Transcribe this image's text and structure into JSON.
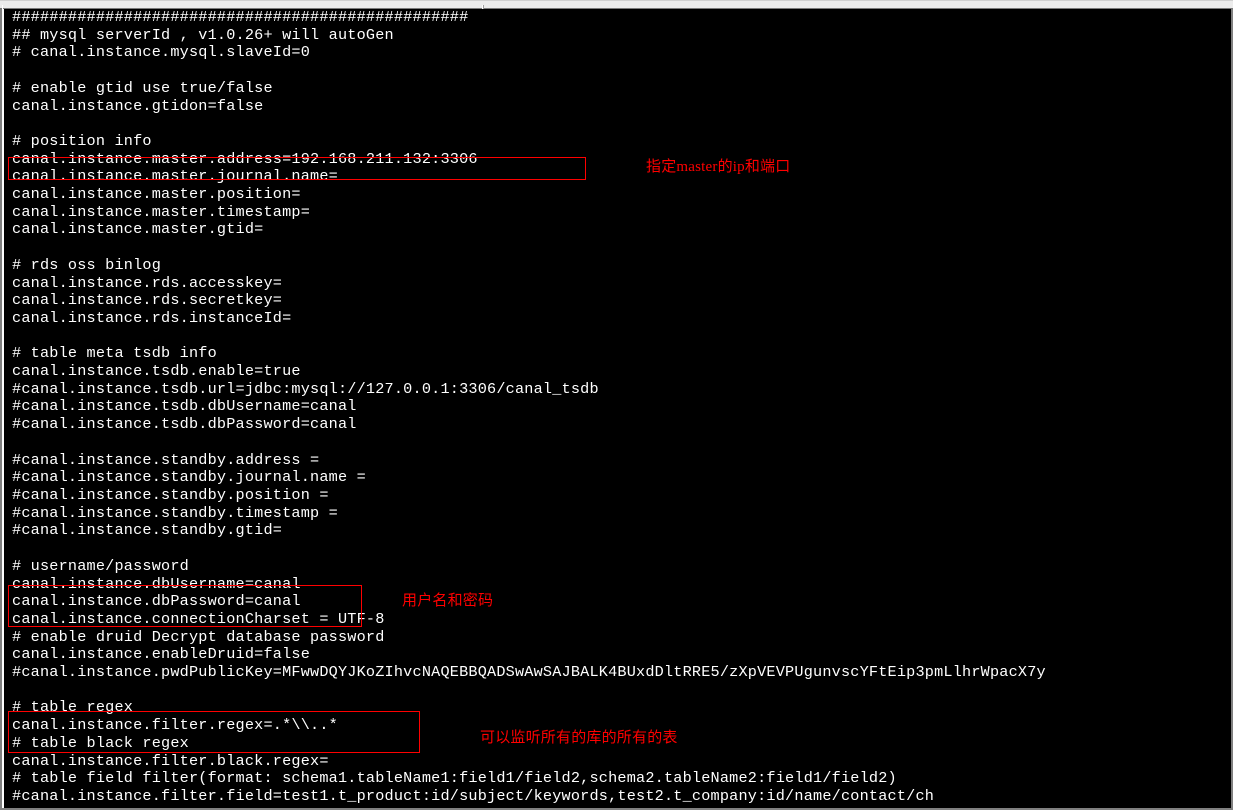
{
  "config_lines": [
    "#################################################",
    "## mysql serverId , v1.0.26+ will autoGen",
    "# canal.instance.mysql.slaveId=0",
    "",
    "# enable gtid use true/false",
    "canal.instance.gtidon=false",
    "",
    "# position info",
    "canal.instance.master.address=192.168.211.132:3306",
    "canal.instance.master.journal.name=",
    "canal.instance.master.position=",
    "canal.instance.master.timestamp=",
    "canal.instance.master.gtid=",
    "",
    "# rds oss binlog",
    "canal.instance.rds.accesskey=",
    "canal.instance.rds.secretkey=",
    "canal.instance.rds.instanceId=",
    "",
    "# table meta tsdb info",
    "canal.instance.tsdb.enable=true",
    "#canal.instance.tsdb.url=jdbc:mysql://127.0.0.1:3306/canal_tsdb",
    "#canal.instance.tsdb.dbUsername=canal",
    "#canal.instance.tsdb.dbPassword=canal",
    "",
    "#canal.instance.standby.address =",
    "#canal.instance.standby.journal.name =",
    "#canal.instance.standby.position =",
    "#canal.instance.standby.timestamp =",
    "#canal.instance.standby.gtid=",
    "",
    "# username/password",
    "canal.instance.dbUsername=canal",
    "canal.instance.dbPassword=canal",
    "canal.instance.connectionCharset = UTF-8",
    "# enable druid Decrypt database password",
    "canal.instance.enableDruid=false",
    "#canal.instance.pwdPublicKey=MFwwDQYJKoZIhvcNAQEBBQADSwAwSAJBALK4BUxdDltRRE5/zXpVEVPUgunvscYFtEip3pmLlhrWpacX7y",
    "",
    "# table regex",
    "canal.instance.filter.regex=.*\\\\..*",
    "# table black regex",
    "canal.instance.filter.black.regex=",
    "# table field filter(format: schema1.tableName1:field1/field2,schema2.tableName2:field1/field2)",
    "#canal.instance.filter.field=test1.t_product:id/subject/keywords,test2.t_company:id/name/contact/ch"
  ],
  "annotations": {
    "box1_label": "指定master的ip和端口",
    "box2_label": "用户名和密码",
    "box3_label": "可以监听所有的库的所有的表"
  }
}
